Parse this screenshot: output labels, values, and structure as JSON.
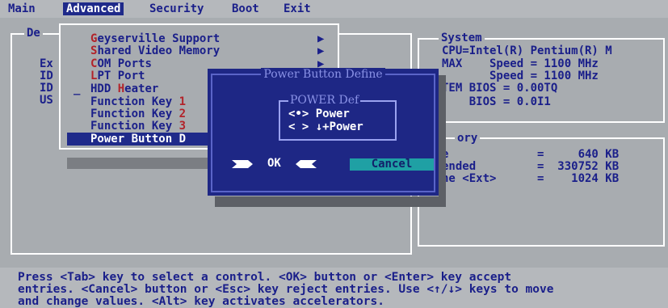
{
  "menu": {
    "tabs": [
      "Main",
      "Advanced",
      "Security",
      "Boot",
      "Exit"
    ],
    "active": "Advanced"
  },
  "left_panel": {
    "legend": "De",
    "rows": [
      "Ex",
      "ID",
      "ID",
      "US"
    ]
  },
  "dropdown": {
    "items": [
      {
        "hot": "G",
        "rest": "eyserville Support",
        "submenu": true
      },
      {
        "hot": "S",
        "rest": "hared Video Memory",
        "submenu": true
      },
      {
        "hot": "C",
        "rest": "OM Ports",
        "submenu": true
      },
      {
        "hot": "L",
        "rest": "PT Port",
        "submenu": true
      },
      {
        "pre": "HDD ",
        "hot": "H",
        "rest": "eater",
        "submenu": false
      },
      {
        "pre": "Function Key ",
        "hot": "1",
        "rest": "",
        "submenu": false
      },
      {
        "pre": "Function Key ",
        "hot": "2",
        "rest": "",
        "submenu": false
      },
      {
        "pre": "Function Key ",
        "hot": "3",
        "rest": "",
        "submenu": false
      },
      {
        "pre": "Power Button D",
        "hot": "",
        "rest": "",
        "submenu": false
      }
    ],
    "dash_marker": "_"
  },
  "system_panel": {
    "legend": "System",
    "lines": [
      "CPU=Intel(R) Pentium(R) M",
      "MAX    Speed = 1100 MHz",
      "       Speed = 1100 MHz",
      "TEM BIOS = 0.00TQ",
      "    BIOS = 0.0I1"
    ]
  },
  "memory_panel": {
    "legend": "ory",
    "lines": [
      "e             =     640 KB",
      "ended         =  330752 KB",
      "he <Ext>      =    1024 KB"
    ]
  },
  "dialog": {
    "title": "Power Button Define",
    "group_legend": "POWER Def",
    "options": [
      "<•> Power",
      "< > ↓+Power"
    ],
    "ok_label": "OK",
    "cancel_label": "Cancel"
  },
  "help": {
    "lines": [
      "Press <Tab> key to select a control. <OK> button or <Enter> key accept",
      "entries. <Cancel> button or <Esc> key reject entries. Use <↑/↓> keys to move",
      "and change values. <Alt> key activates accelerators."
    ]
  },
  "colors": {
    "background": "#a8acb0",
    "text": "#1a1f8a",
    "hotkey": "#b2232a",
    "dialog": "#1e2785",
    "cancel_button": "#1fa0a4"
  }
}
